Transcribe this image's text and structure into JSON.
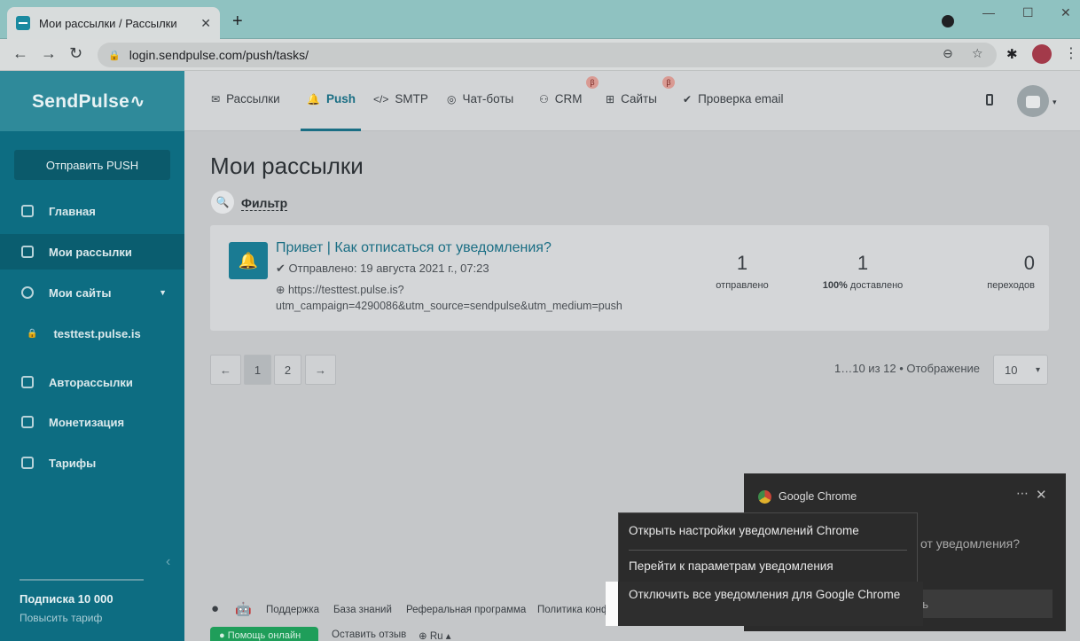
{
  "browser": {
    "tab_title": "Мои рассылки / Рассылки",
    "tab_close": "✕",
    "new_tab": "+",
    "url": "login.sendpulse.com/push/tasks/",
    "back": "←",
    "forward": "→",
    "reload": "↻",
    "min": "—",
    "max": "☐",
    "close": "✕",
    "zoom_icon": "⊖",
    "star_icon": "☆",
    "ext_icon": "✱",
    "menu_icon": "⋮"
  },
  "sidebar": {
    "brand": "SendPulse∿",
    "send_button": "Отправить PUSH",
    "items": [
      {
        "label": "Главная"
      },
      {
        "label": "Мои рассылки"
      },
      {
        "label": "Мои сайты"
      },
      {
        "label": "testtest.pulse.is"
      },
      {
        "label": "Авторассылки"
      },
      {
        "label": "Монетизация"
      },
      {
        "label": "Тарифы"
      }
    ],
    "collapse": "‹",
    "plan": "Подписка 10 000",
    "upgrade": "Повысить тариф"
  },
  "topnav": {
    "items": [
      {
        "icon": "✉",
        "label": "Рассылки"
      },
      {
        "icon": "🔔",
        "label": "Push"
      },
      {
        "icon": "</>",
        "label": "SMTP"
      },
      {
        "icon": "◎",
        "label": "Чат-боты"
      },
      {
        "icon": "⚇",
        "label": "CRM"
      },
      {
        "icon": "⊞",
        "label": "Сайты"
      },
      {
        "icon": "✔",
        "label": "Проверка email"
      }
    ],
    "beta": "β",
    "avatar_caret": "▾"
  },
  "main": {
    "title": "Мои рассылки",
    "filter_icon": "🔍",
    "filter": "Фильтр",
    "campaign": {
      "title": "Привет | Как отписаться от уведомления?",
      "sent": "✔ Отправлено: 19 августа 2021 г., 07:23",
      "url": "⊕ https://testtest.pulse.is?utm_campaign=4290086&utm_source=sendpulse&utm_medium=push",
      "stats": [
        {
          "num": "1",
          "label": "отправлено"
        },
        {
          "num": "1",
          "label_bold": "100%",
          "label": " доставлено"
        },
        {
          "num": "0",
          "label": "переходов"
        }
      ]
    },
    "pager": {
      "prev": "←",
      "pages": [
        "1",
        "2"
      ],
      "next": "→",
      "range": "1…10 из 12  •  Отображение",
      "per_page": "10",
      "per_page_caret": "▾"
    }
  },
  "footer": {
    "apple": "",
    "android": "🤖",
    "links": [
      "Поддержка",
      "База знаний",
      "Реферальная программа",
      "Политика конфи"
    ],
    "help": "● Помощь онлайн",
    "review": "Оставить отзыв",
    "lang": "⊕ Ru ▴"
  },
  "notification": {
    "app": "Google Chrome",
    "dots": "⋯",
    "close": "✕",
    "body": "от уведомления?",
    "action": "ть"
  },
  "context_menu": {
    "items": [
      "Открыть настройки уведомлений Chrome",
      "Перейти к параметрам уведомления",
      "Отключить все уведомления для Google Chrome"
    ]
  }
}
